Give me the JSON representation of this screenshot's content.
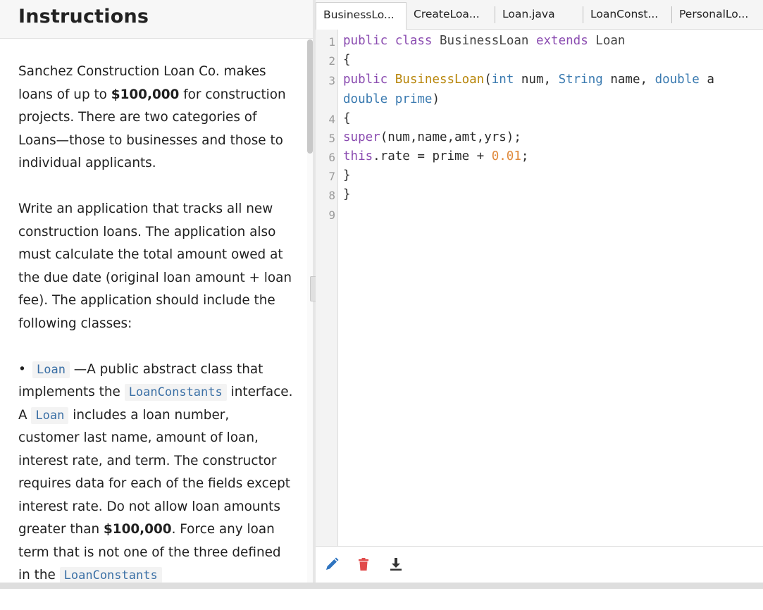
{
  "instructions": {
    "title": "Instructions",
    "p1_a": "Sanchez Construction Loan Co. makes loans of up to ",
    "p1_amount": "$100,000",
    "p1_b": " for construction projects. There are two categories of Loans—those to businesses and those to individual applicants.",
    "p2": "Write an application that tracks all new construction loans. The application also must calculate the total amount owed at the due date (original loan amount + loan fee). The application should include the following classes:",
    "bullet_glyph": "•",
    "b1_chip1": "Loan",
    "b1_t1": " —A public abstract class that implements the ",
    "b1_chip2": "LoanConstants",
    "b1_t2": " interface. A ",
    "b1_chip3": "Loan",
    "b1_t3": " includes a loan number, customer last name, amount of loan, interest rate, and term. The constructor requires data for each of the fields except interest rate. Do not allow loan amounts greater than ",
    "b1_amount": "$100,000",
    "b1_t4": ". Force any loan term that is not one of the three defined in the ",
    "b1_chip4": "LoanConstants"
  },
  "tabs": [
    {
      "label": "BusinessLo...",
      "active": true
    },
    {
      "label": "CreateLoa...",
      "active": false
    },
    {
      "label": "Loan.java",
      "active": false
    },
    {
      "label": "LoanConst...",
      "active": false
    },
    {
      "label": "PersonalLo...",
      "active": false
    }
  ],
  "editor": {
    "line_numbers": [
      "1",
      "2",
      "3",
      "",
      "4",
      "5",
      "6",
      "7",
      "8",
      "9"
    ],
    "code": {
      "l1_kw1": "public",
      "l1_kw2": "class",
      "l1_name": "BusinessLoan",
      "l1_kw3": "extends",
      "l1_base": "Loan",
      "l2": "{",
      "l3_kw": "public",
      "l3_fn": "BusinessLoan",
      "l3_paren": "(",
      "l3_t1": "int",
      "l3_a1": " num, ",
      "l3_t2": "String",
      "l3_a2": " name, ",
      "l3_t3": "double",
      "l3_a3": " a",
      "l3b_t": "double",
      "l3b_a": " prime",
      "l3b_close": ")",
      "l4": "{",
      "l5_kw": "super",
      "l5_rest": "(num,name,amt,yrs);",
      "l6_kw": "this",
      "l6_mid": ".rate = prime + ",
      "l6_num": "0.01",
      "l6_end": ";",
      "l7": "}",
      "l8": "}"
    }
  },
  "toolbar": {
    "edit_icon": "pencil-icon",
    "delete_icon": "trash-icon",
    "download_icon": "download-icon"
  },
  "colors": {
    "keyword": "#8a4bb0",
    "type": "#3a7ab0",
    "function": "#b8860b",
    "number": "#e08a3c",
    "pencil": "#2f74c0",
    "trash": "#e14b4b"
  }
}
